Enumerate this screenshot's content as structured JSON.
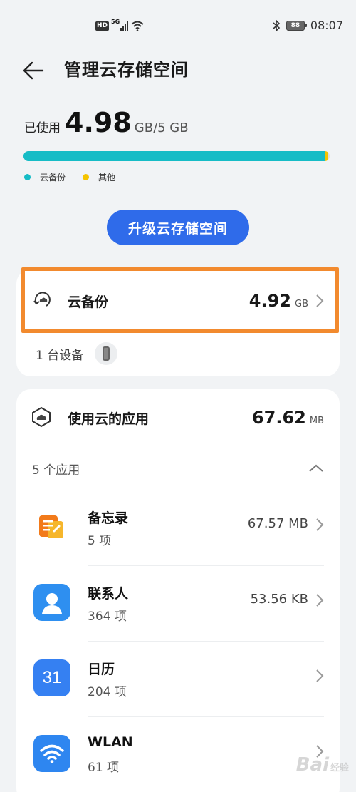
{
  "status_bar": {
    "hd": "HD",
    "network": "5G",
    "battery": "88",
    "time": "08:07"
  },
  "header": {
    "title": "管理云存储空间",
    "back_icon": "back-arrow-icon"
  },
  "usage": {
    "used_label": "已使用",
    "used_value": "4.98",
    "used_total": "GB/5 GB",
    "backup_fraction": 0.984,
    "other_fraction": 0.012,
    "legend": [
      {
        "label": "云备份",
        "color": "#16bcc6"
      },
      {
        "label": "其他",
        "color": "#f5c400"
      }
    ]
  },
  "upgrade_button": "升级云存储空间",
  "backup_card": {
    "title": "云备份",
    "size": "4.92",
    "unit": "GB",
    "device_text": "1 台设备",
    "highlight_color": "#f28a2e"
  },
  "apps_card": {
    "title": "使用云的应用",
    "size": "67.62",
    "unit": "MB",
    "count_text": "5 个应用",
    "apps": [
      {
        "name": "备忘录",
        "count": "5 项",
        "size": "67.57 MB",
        "icon": "notepad-icon"
      },
      {
        "name": "联系人",
        "count": "364 项",
        "size": "53.56 KB",
        "icon": "contacts-icon"
      },
      {
        "name": "日历",
        "count": "204 项",
        "size": "",
        "icon": "calendar-icon",
        "icon_text": "31"
      },
      {
        "name": "WLAN",
        "count": "61 项",
        "size": "",
        "icon": "wifi-icon"
      }
    ]
  },
  "watermark": {
    "text": "Bai",
    "suffix": "经验"
  }
}
